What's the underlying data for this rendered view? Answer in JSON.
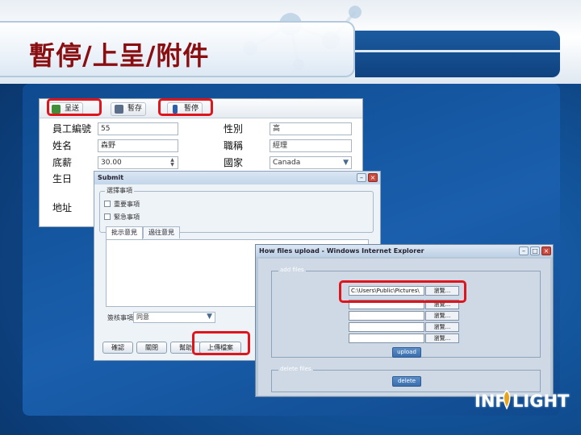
{
  "slide": {
    "title": "暫停/上呈/附件",
    "logo": "INF LIGHT"
  },
  "form_window": {
    "toolbar": {
      "submit": "呈送",
      "save": "暫存",
      "pause": "暫停"
    },
    "fields": {
      "employee_no_label": "員工編號",
      "employee_no_value": "55",
      "name_label": "姓名",
      "name_value": "森野",
      "salary_label": "底薪",
      "salary_value": "30.00",
      "birthday_label": "生日",
      "address_label": "地址",
      "gender_label": "性別",
      "gender_value": "高",
      "title_label": "職稱",
      "title_value": "經理",
      "country_label": "國家",
      "country_value": "Canada"
    }
  },
  "submit_window": {
    "title": "Submit",
    "options_group": "選擇事項",
    "option_important": "重要事項",
    "option_urgent": "緊急事項",
    "tab_comments": "批示意見",
    "tab_history": "過往意見",
    "signature_label": "簽核事項",
    "signature_value": "同意",
    "buttons": [
      "確認",
      "關閉",
      "幫助",
      "上傳檔案"
    ]
  },
  "ie_window": {
    "title": "How files upload - Windows Internet Explorer",
    "add_files": "add files",
    "file_path": "C:\\Users\\Public\\Pictures\\",
    "browse": "瀏覽...",
    "upload": "upload",
    "delete_files": "delete files",
    "delete": "delete"
  },
  "colors": {
    "title_red": "#8a0d10",
    "highlight_red": "#e0151b",
    "slide_blue": "#125399"
  }
}
